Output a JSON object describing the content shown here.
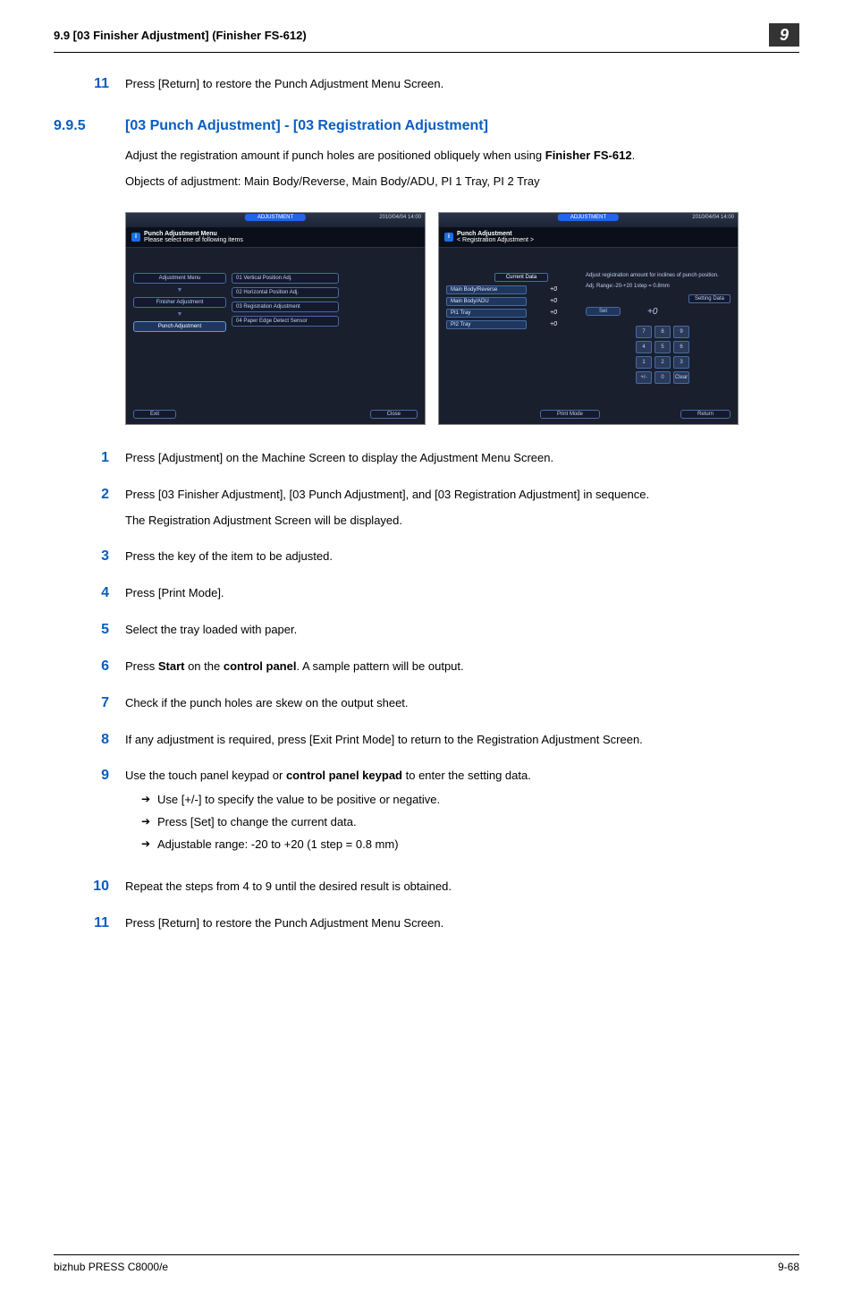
{
  "header": {
    "left": "9.9    [03 Finisher Adjustment] (Finisher FS-612)",
    "chapter": "9"
  },
  "top_step": {
    "num": "11",
    "text": "Press [Return] to restore the Punch Adjustment Menu Screen."
  },
  "section": {
    "num": "9.9.5",
    "title": "[03 Punch Adjustment] - [03 Registration Adjustment]"
  },
  "intro": {
    "p1_before": "Adjust the registration amount if punch holes are positioned obliquely when using ",
    "p1_bold": "Finisher FS-612",
    "p1_after": ".",
    "p2": "Objects of adjustment: Main Body/Reverse, Main Body/ADU, PI 1 Tray, PI 2 Tray"
  },
  "shot1": {
    "titlebar_pill": "ADJUSTMENT",
    "titlebar_right": "2010/04/04  14:00",
    "header_line1": "Punch Adjustment Menu",
    "header_line2": "Please select one of following items",
    "nav": [
      "Adjustment Menu",
      "Finisher Adjustment",
      "Punch Adjustment"
    ],
    "opts": [
      "01 Vertical Position Adj.",
      "02 Horizontal Position Adj.",
      "03 Registration Adjustment",
      "04 Paper Edge Detect Sensor"
    ],
    "foot_left": "Exit",
    "foot_right": "Close"
  },
  "shot2": {
    "titlebar_pill": "ADJUSTMENT",
    "titlebar_right": "2010/04/04  14:00",
    "header_line1": "Punch Adjustment",
    "header_line2": "< Registration Adjustment >",
    "current_data": "Current Data",
    "desc": "Adjust registration amount for inclines of punch position.",
    "range": "Adj. Range:-20-+20  1step = 0.8mm",
    "rows": [
      {
        "label": "Main Body/Reverse",
        "val": "+0"
      },
      {
        "label": "Main Body/ADU",
        "val": "+0"
      },
      {
        "label": "PI1 Tray",
        "val": "+0"
      },
      {
        "label": "PI2 Tray",
        "val": "+0"
      }
    ],
    "setting_data": "Setting Data",
    "set_btn": "Set",
    "set_val": "+0",
    "keys": [
      "7",
      "8",
      "9",
      "4",
      "5",
      "6",
      "1",
      "2",
      "3",
      "+/-",
      "0",
      "Clear"
    ],
    "foot_mid": "Print Mode",
    "foot_right": "Return"
  },
  "steps": [
    {
      "num": "1",
      "html": "Press [Adjustment] on the Machine Screen to display the Adjustment Menu Screen."
    },
    {
      "num": "2",
      "html": "Press [03 Finisher Adjustment], [03 Punch Adjustment], and [03 Registration Adjustment] in sequence.",
      "sub": "The Registration Adjustment Screen will be displayed."
    },
    {
      "num": "3",
      "html": "Press the key of the item to be adjusted."
    },
    {
      "num": "4",
      "html": "Press [Print Mode]."
    },
    {
      "num": "5",
      "html": "Select the tray loaded with paper."
    },
    {
      "num": "6",
      "pre": "Press ",
      "b1": "Start",
      "mid": " on the ",
      "b2": "control panel",
      "post": ". A sample pattern will be output."
    },
    {
      "num": "7",
      "html": " Check if the punch holes are skew on the output sheet."
    },
    {
      "num": "8",
      "html": "If any adjustment is required, press [Exit Print Mode] to return to the Registration Adjustment Screen."
    },
    {
      "num": "9",
      "pre": "Use the touch panel keypad or ",
      "b1": "control panel keypad",
      "post": " to enter the setting data.",
      "bullets": [
        "Use [+/-] to specify the value to be positive or negative.",
        "Press [Set] to change the current data.",
        "Adjustable range: -20 to +20 (1 step = 0.8 mm)"
      ]
    },
    {
      "num": "10",
      "html": "Repeat the steps from 4 to 9 until the desired result is obtained."
    },
    {
      "num": "11",
      "html": "Press [Return] to restore the Punch Adjustment Menu Screen."
    }
  ],
  "footer": {
    "left": "bizhub PRESS C8000/e",
    "right": "9-68"
  }
}
